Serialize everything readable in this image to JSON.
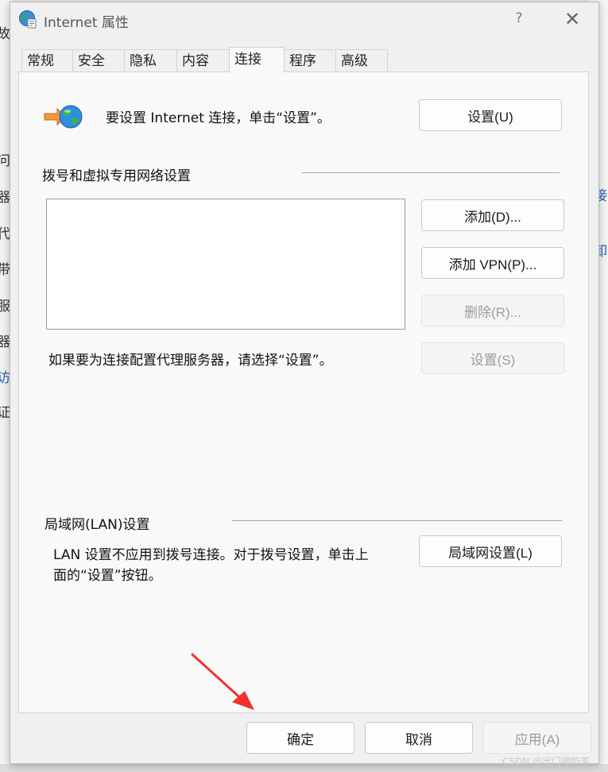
{
  "window": {
    "title": "Internet 属性",
    "help": "?",
    "close": "✕"
  },
  "tabs": [
    {
      "label": "常规"
    },
    {
      "label": "安全"
    },
    {
      "label": "隐私"
    },
    {
      "label": "内容"
    },
    {
      "label": "连接",
      "active": true
    },
    {
      "label": "程序"
    },
    {
      "label": "高级"
    }
  ],
  "setup": {
    "text": "要设置 Internet 连接，单击“设置”。",
    "button": "设置(U)"
  },
  "dialup": {
    "heading": "拨号和虚拟专用网络设置",
    "add_button": "添加(D)...",
    "add_vpn_button": "添加 VPN(P)...",
    "delete_button": "删除(R)...",
    "proxy_text": "如果要为连接配置代理服务器，请选择“设置”。",
    "settings_button": "设置(S)"
  },
  "lan": {
    "heading": "局域网(LAN)设置",
    "text_line1": "LAN 设置不应用到拨号连接。对于拨号设置，单击上",
    "text_line2": "面的“设置”按钮。",
    "button": "局域网设置(L)"
  },
  "footer": {
    "ok": "确定",
    "cancel": "取消",
    "apply": "应用(A)"
  },
  "background": {
    "left_chars": [
      "问",
      "器",
      "代",
      "带",
      "服",
      "器",
      "访",
      "证"
    ],
    "right_chars": [
      "接",
      "卸"
    ]
  },
  "watermark": "CSDN @出门喝奶茶",
  "colors": {
    "arrow": "#f0322a",
    "link_blue": "#1f5fb0"
  }
}
